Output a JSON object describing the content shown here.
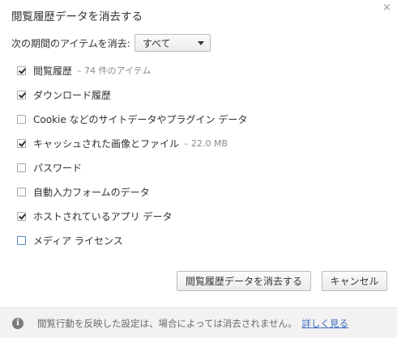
{
  "dialog": {
    "title": "閲覧履歴データを消去する",
    "close_glyph": "×"
  },
  "period": {
    "label": "次の期間のアイテムを消去:",
    "selected": "すべて"
  },
  "options": [
    {
      "label": "閲覧履歴",
      "detail": "– 74 件のアイテム",
      "checked": true
    },
    {
      "label": "ダウンロード履歴",
      "detail": "",
      "checked": true
    },
    {
      "label": "Cookie などのサイトデータやプラグイン データ",
      "detail": "",
      "checked": false
    },
    {
      "label": "キャッシュされた画像とファイル",
      "detail": "– 22.0 MB",
      "checked": true
    },
    {
      "label": "パスワード",
      "detail": "",
      "checked": false
    },
    {
      "label": "自動入力フォームのデータ",
      "detail": "",
      "checked": false
    },
    {
      "label": "ホストされているアプリ データ",
      "detail": "",
      "checked": true
    },
    {
      "label": "メディア ライセンス",
      "detail": "",
      "checked": false
    }
  ],
  "buttons": {
    "clear": "閲覧履歴データを消去する",
    "cancel": "キャンセル"
  },
  "footer": {
    "info_glyph": "i",
    "text": "閲覧行動を反映した設定は、場合によっては消去されません。",
    "link": "詳しく見る"
  },
  "colors": {
    "link": "#3a69c2",
    "footer_bg": "#f2f2f2",
    "focused_checkbox_border": "#5b86c6"
  }
}
